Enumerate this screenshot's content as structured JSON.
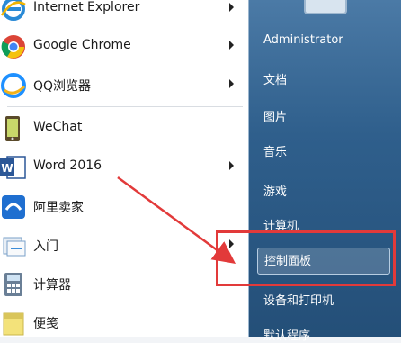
{
  "programs": [
    {
      "label": "Internet Explorer",
      "icon": "internet-explorer-icon",
      "has_arrow": true
    },
    {
      "label": "Google Chrome",
      "icon": "chrome-icon",
      "has_arrow": true
    },
    {
      "label": "QQ浏览器",
      "icon": "qq-browser-icon",
      "has_arrow": true
    },
    {
      "label": "WeChat",
      "icon": "wechat-icon",
      "has_arrow": false
    },
    {
      "label": "Word 2016",
      "icon": "word-icon",
      "has_arrow": true
    },
    {
      "label": "阿里卖家",
      "icon": "ali-seller-icon",
      "has_arrow": false
    },
    {
      "label": "入门",
      "icon": "getting-started-icon",
      "has_arrow": true
    },
    {
      "label": "计算器",
      "icon": "calculator-icon",
      "has_arrow": false
    },
    {
      "label": "便笺",
      "icon": "sticky-notes-icon",
      "has_arrow": false
    }
  ],
  "right_panel": {
    "user": "Administrator",
    "items": [
      "文档",
      "图片",
      "音乐",
      "游戏",
      "计算机",
      "控制面板",
      "设备和打印机",
      "默认程序"
    ],
    "highlighted": "控制面板"
  },
  "annotation": {
    "color": "#e23a3a"
  },
  "colors": {
    "panel": "#2f5f8c",
    "accent_red": "#e23a3a"
  }
}
